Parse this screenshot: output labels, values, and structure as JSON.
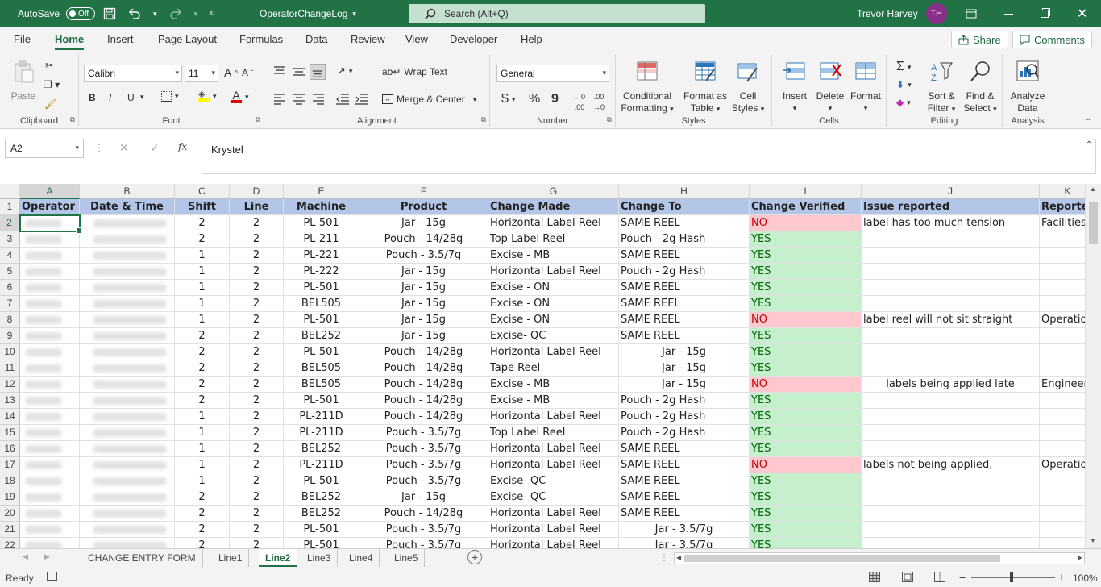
{
  "titlebar": {
    "autosave_label": "AutoSave",
    "autosave_state": "Off",
    "filename": "OperatorChangeLog",
    "search_placeholder": "Search (Alt+Q)",
    "user_name": "Trevor Harvey",
    "user_initials": "TH"
  },
  "menu": {
    "items": [
      "File",
      "Home",
      "Insert",
      "Page Layout",
      "Formulas",
      "Data",
      "Review",
      "View",
      "Developer",
      "Help"
    ],
    "active": "Home",
    "share": "Share",
    "comments": "Comments"
  },
  "ribbon": {
    "clipboard": {
      "label": "Clipboard",
      "paste": "Paste"
    },
    "font": {
      "label": "Font",
      "name": "Calibri",
      "size": "11",
      "bold": "B",
      "italic": "I",
      "underline": "U"
    },
    "alignment": {
      "label": "Alignment",
      "wrap": "Wrap Text",
      "merge": "Merge & Center"
    },
    "number": {
      "label": "Number",
      "format": "General",
      "currency": "$",
      "percent": "%",
      "comma": "9"
    },
    "styles": {
      "label": "Styles",
      "conditional": [
        "Conditional",
        "Formatting"
      ],
      "format_table": [
        "Format as",
        "Table"
      ],
      "cell_styles": [
        "Cell",
        "Styles"
      ]
    },
    "cells": {
      "label": "Cells",
      "insert": "Insert",
      "delete": "Delete",
      "format": "Format"
    },
    "editing": {
      "label": "Editing",
      "sort": [
        "Sort &",
        "Filter"
      ],
      "find": [
        "Find &",
        "Select"
      ]
    },
    "analysis": {
      "label": "Analysis",
      "analyze": [
        "Analyze",
        "Data"
      ]
    }
  },
  "formula_bar": {
    "name_box": "A2",
    "fx": "fx",
    "content": "Krystel"
  },
  "columns": [
    "A",
    "B",
    "C",
    "D",
    "E",
    "F",
    "G",
    "H",
    "I",
    "J",
    "K"
  ],
  "selected_column": "A",
  "headers": [
    "Operator",
    "Date & Time",
    "Shift",
    "Line",
    "Machine",
    "Product",
    "Change Made",
    "Change To",
    "Change Verified",
    "Issue reported",
    "Reported"
  ],
  "row_numbers": [
    "1",
    "2",
    "3",
    "4",
    "5",
    "6",
    "7",
    "8",
    "9",
    "10",
    "11",
    "12",
    "13",
    "14",
    "15",
    "16",
    "17",
    "18",
    "19",
    "20",
    "21",
    "22"
  ],
  "selected_row": "2",
  "rows": [
    {
      "shift": "2",
      "line": "2",
      "machine": "PL-501",
      "product": "Jar - 15g",
      "change": "Horizontal Label Reel",
      "to": "SAME REEL",
      "verified": "NO",
      "issue": "label has too much tension",
      "reported": "Facilities"
    },
    {
      "shift": "2",
      "line": "2",
      "machine": "PL-211",
      "product": "Pouch - 14/28g",
      "change": "Top Label Reel",
      "to": "Pouch - 2g Hash",
      "verified": "YES",
      "issue": "",
      "reported": ""
    },
    {
      "shift": "1",
      "line": "2",
      "machine": "PL-221",
      "product": "Pouch - 3.5/7g",
      "change": "Excise - MB",
      "to": "SAME REEL",
      "verified": "YES",
      "issue": "",
      "reported": ""
    },
    {
      "shift": "1",
      "line": "2",
      "machine": "PL-222",
      "product": "Jar - 15g",
      "change": "Horizontal Label Reel",
      "to": "Pouch - 2g Hash",
      "verified": "YES",
      "issue": "",
      "reported": ""
    },
    {
      "shift": "1",
      "line": "2",
      "machine": "PL-501",
      "product": "Jar - 15g",
      "change": "Excise - ON",
      "to": "SAME REEL",
      "verified": "YES",
      "issue": "",
      "reported": ""
    },
    {
      "shift": "1",
      "line": "2",
      "machine": "BEL505",
      "product": "Jar - 15g",
      "change": "Excise - ON",
      "to": "SAME REEL",
      "verified": "YES",
      "issue": "",
      "reported": ""
    },
    {
      "shift": "1",
      "line": "2",
      "machine": "PL-501",
      "product": "Jar - 15g",
      "change": "Excise - ON",
      "to": "SAME REEL",
      "verified": "NO",
      "issue": "label reel will not sit straight",
      "reported": "Operations"
    },
    {
      "shift": "2",
      "line": "2",
      "machine": "BEL252",
      "product": "Jar - 15g",
      "change": "Excise- QC",
      "to": "SAME REEL",
      "verified": "YES",
      "issue": "",
      "reported": ""
    },
    {
      "shift": "2",
      "line": "2",
      "machine": "PL-501",
      "product": "Pouch - 14/28g",
      "change": "Horizontal Label Reel",
      "to": "Jar - 15g",
      "to_center": true,
      "verified": "YES",
      "issue": "",
      "reported": ""
    },
    {
      "shift": "2",
      "line": "2",
      "machine": "BEL505",
      "product": "Pouch - 14/28g",
      "change": "Tape Reel",
      "to": "Jar - 15g",
      "to_center": true,
      "verified": "YES",
      "issue": "",
      "reported": ""
    },
    {
      "shift": "2",
      "line": "2",
      "machine": "BEL505",
      "product": "Pouch - 14/28g",
      "change": "Excise - MB",
      "to": "Jar - 15g",
      "to_center": true,
      "verified": "NO",
      "issue": "labels being applied late",
      "issue_center": true,
      "reported": "Engineering"
    },
    {
      "shift": "2",
      "line": "2",
      "machine": "PL-501",
      "product": "Pouch - 14/28g",
      "change": "Excise - MB",
      "to": "Pouch - 2g Hash",
      "verified": "YES",
      "issue": "",
      "reported": ""
    },
    {
      "shift": "1",
      "line": "2",
      "machine": "PL-211D",
      "product": "Pouch - 14/28g",
      "change": "Horizontal Label Reel",
      "to": "Pouch - 2g Hash",
      "verified": "YES",
      "issue": "",
      "reported": ""
    },
    {
      "shift": "1",
      "line": "2",
      "machine": "PL-211D",
      "product": "Pouch - 3.5/7g",
      "change": "Top Label Reel",
      "to": "Pouch - 2g Hash",
      "verified": "YES",
      "issue": "",
      "reported": ""
    },
    {
      "shift": "1",
      "line": "2",
      "machine": "BEL252",
      "product": "Pouch - 3.5/7g",
      "change": "Horizontal Label Reel",
      "to": "SAME REEL",
      "verified": "YES",
      "issue": "",
      "reported": ""
    },
    {
      "shift": "1",
      "line": "2",
      "machine": "PL-211D",
      "product": "Pouch - 3.5/7g",
      "change": "Horizontal Label Reel",
      "to": "SAME REEL",
      "verified": "NO",
      "issue": "labels not being applied,",
      "reported": "Operations"
    },
    {
      "shift": "1",
      "line": "2",
      "machine": "PL-501",
      "product": "Pouch - 3.5/7g",
      "change": "Excise- QC",
      "to": "SAME REEL",
      "verified": "YES",
      "issue": "",
      "reported": ""
    },
    {
      "shift": "2",
      "line": "2",
      "machine": "BEL252",
      "product": "Jar - 15g",
      "change": "Excise- QC",
      "to": "SAME REEL",
      "verified": "YES",
      "issue": "",
      "reported": ""
    },
    {
      "shift": "2",
      "line": "2",
      "machine": "BEL252",
      "product": "Pouch - 14/28g",
      "change": "Horizontal Label Reel",
      "to": "SAME REEL",
      "verified": "YES",
      "issue": "",
      "reported": ""
    },
    {
      "shift": "2",
      "line": "2",
      "machine": "PL-501",
      "product": "Pouch - 3.5/7g",
      "change": "Horizontal Label Reel",
      "to": "Jar  - 3.5/7g",
      "to_center": true,
      "verified": "YES",
      "issue": "",
      "reported": ""
    },
    {
      "shift": "2",
      "line": "2",
      "machine": "PL-501",
      "product": "Pouch - 3.5/7g",
      "change": "Horizontal Label Reel",
      "to": "Jar  - 3.5/7g",
      "to_center": true,
      "verified": "YES",
      "issue": "",
      "reported": ""
    }
  ],
  "sheet_tabs": [
    "CHANGE ENTRY FORM",
    "Line1",
    "Line2",
    "Line3",
    "Line4",
    "Line5"
  ],
  "active_tab": "Line2",
  "status": {
    "ready": "Ready",
    "zoom": "100%"
  },
  "colors": {
    "excel_green": "#217346",
    "header_fill": "#b4c6e7",
    "no_fill": "#ffc7ce",
    "no_text": "#c00000",
    "yes_fill": "#c6efce",
    "yes_text": "#006100"
  }
}
